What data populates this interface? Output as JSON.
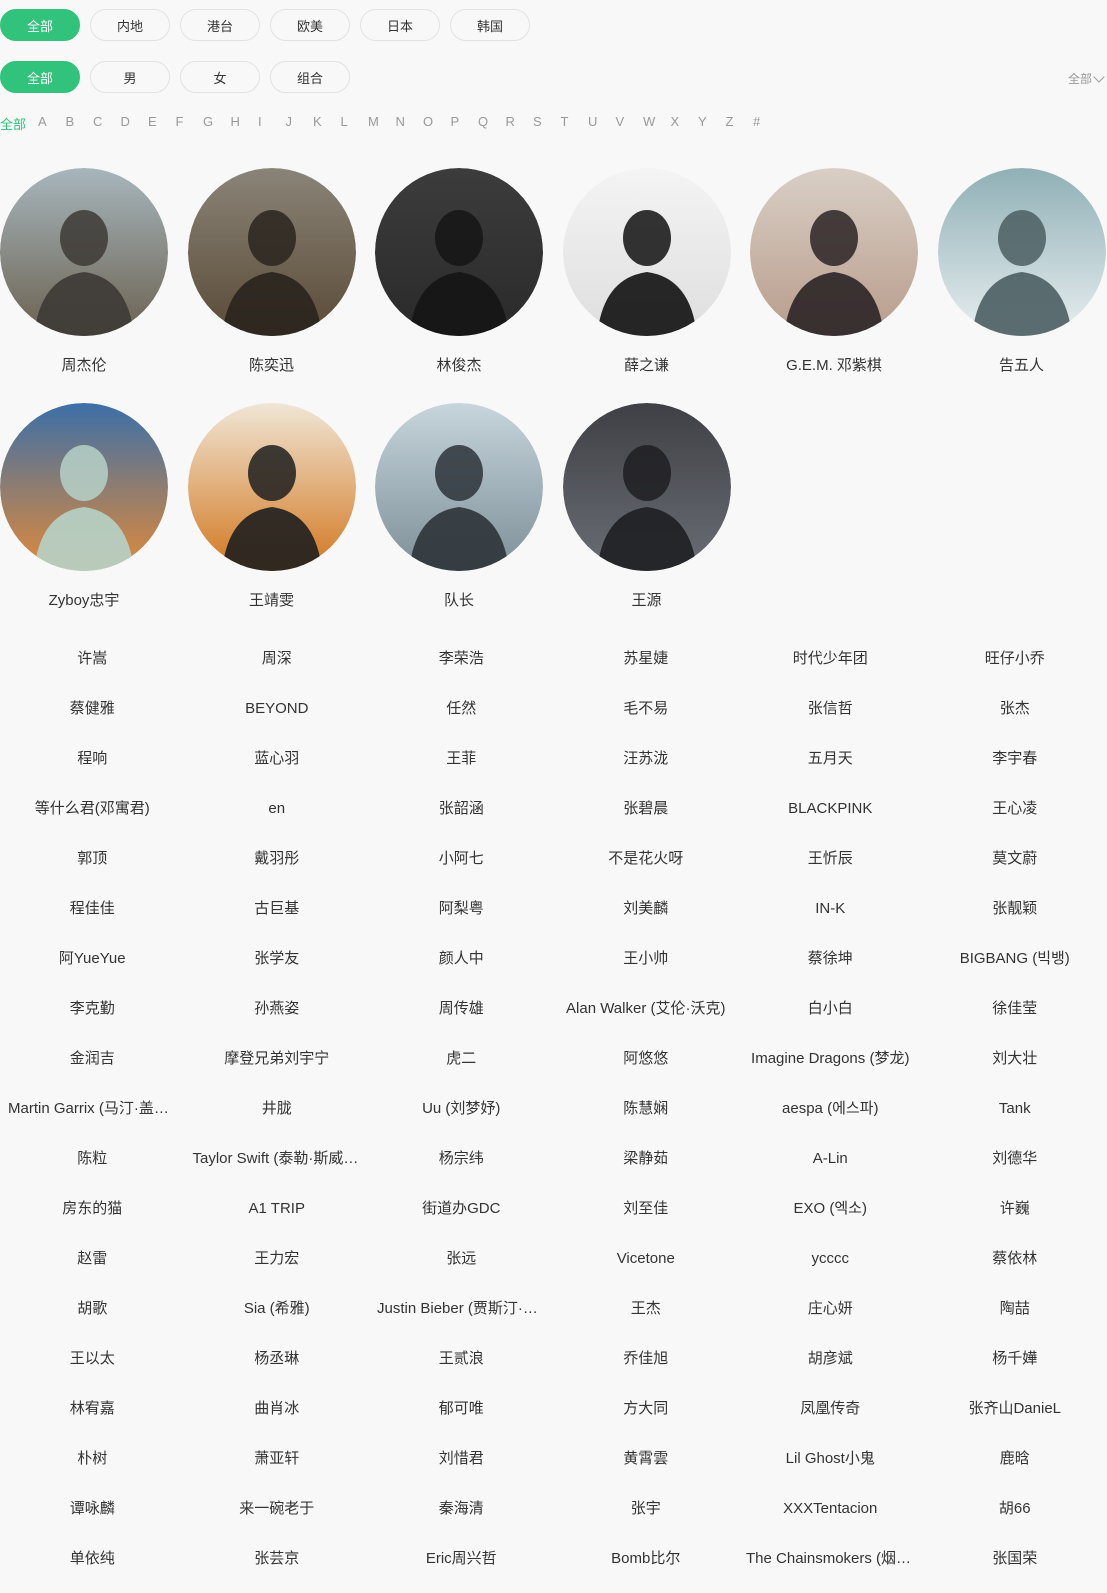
{
  "region_filters": [
    "全部",
    "内地",
    "港台",
    "欧美",
    "日本",
    "韩国"
  ],
  "type_filters": [
    "全部",
    "男",
    "女",
    "组合"
  ],
  "sort": {
    "label": "全部"
  },
  "letters": [
    "全部",
    "A",
    "B",
    "C",
    "D",
    "E",
    "F",
    "G",
    "H",
    "I",
    "J",
    "K",
    "L",
    "M",
    "N",
    "O",
    "P",
    "Q",
    "R",
    "S",
    "T",
    "U",
    "V",
    "W",
    "X",
    "Y",
    "Z",
    "#"
  ],
  "featured": [
    {
      "name": "周杰伦"
    },
    {
      "name": "陈奕迅"
    },
    {
      "name": "林俊杰"
    },
    {
      "name": "薛之谦"
    },
    {
      "name": "G.E.M. 邓紫棋"
    },
    {
      "name": "告五人"
    },
    {
      "name": "Zyboy忠宇"
    },
    {
      "name": "王靖雯"
    },
    {
      "name": "队长"
    },
    {
      "name": "王源"
    }
  ],
  "names": [
    [
      "许嵩",
      "周深",
      "李荣浩",
      "苏星婕",
      "时代少年团",
      "旺仔小乔"
    ],
    [
      "蔡健雅",
      "BEYOND",
      "任然",
      "毛不易",
      "张信哲",
      "张杰"
    ],
    [
      "程响",
      "蓝心羽",
      "王菲",
      "汪苏泷",
      "五月天",
      "李宇春"
    ],
    [
      "等什么君(邓寓君)",
      "en",
      "张韶涵",
      "张碧晨",
      "BLACKPINK",
      "王心凌"
    ],
    [
      "郭顶",
      "戴羽彤",
      "小阿七",
      "不是花火呀",
      "王忻辰",
      "莫文蔚"
    ],
    [
      "程佳佳",
      "古巨基",
      "阿梨粤",
      "刘美麟",
      "IN-K",
      "张靓颖"
    ],
    [
      "阿YueYue",
      "张学友",
      "颜人中",
      "王小帅",
      "蔡徐坤",
      "BIGBANG (빅뱅)"
    ],
    [
      "李克勤",
      "孙燕姿",
      "周传雄",
      "Alan Walker (艾伦·沃克)",
      "白小白",
      "徐佳莹"
    ],
    [
      "金润吉",
      "摩登兄弟刘宇宁",
      "虎二",
      "阿悠悠",
      "Imagine Dragons (梦龙)",
      "刘大壮"
    ],
    [
      "Martin Garrix (马汀·盖瑞斯)",
      "井胧",
      "Uu (刘梦妤)",
      "陈慧娴",
      "aespa (에스파)",
      "Tank"
    ],
    [
      "陈粒",
      "Taylor Swift (泰勒·斯威夫特)",
      "杨宗纬",
      "梁静茹",
      "A-Lin",
      "刘德华"
    ],
    [
      "房东的猫",
      "A1 TRIP",
      "街道办GDC",
      "刘至佳",
      "EXO (엑소)",
      "许巍"
    ],
    [
      "赵雷",
      "王力宏",
      "张远",
      "Vicetone",
      "ycccc",
      "蔡依林"
    ],
    [
      "胡歌",
      "Sia (希雅)",
      "Justin Bieber (贾斯汀·比伯)",
      "王杰",
      "庄心妍",
      "陶喆"
    ],
    [
      "王以太",
      "杨丞琳",
      "王贰浪",
      "乔佳旭",
      "胡彦斌",
      "杨千嬅"
    ],
    [
      "林宥嘉",
      "曲肖冰",
      "郁可唯",
      "方大同",
      "凤凰传奇",
      "张齐山DanieL"
    ],
    [
      "朴树",
      "萧亚轩",
      "刘惜君",
      "黄霄雲",
      "Lil Ghost小鬼",
      "鹿晗"
    ],
    [
      "谭咏麟",
      "来一碗老于",
      "秦海清",
      "张宇",
      "XXXTentacion",
      "胡66"
    ],
    [
      "单依纯",
      "张芸京",
      "Eric周兴哲",
      "Bomb比尔",
      "The Chainsmokers (烟鬼组合)",
      "张国荣"
    ]
  ]
}
